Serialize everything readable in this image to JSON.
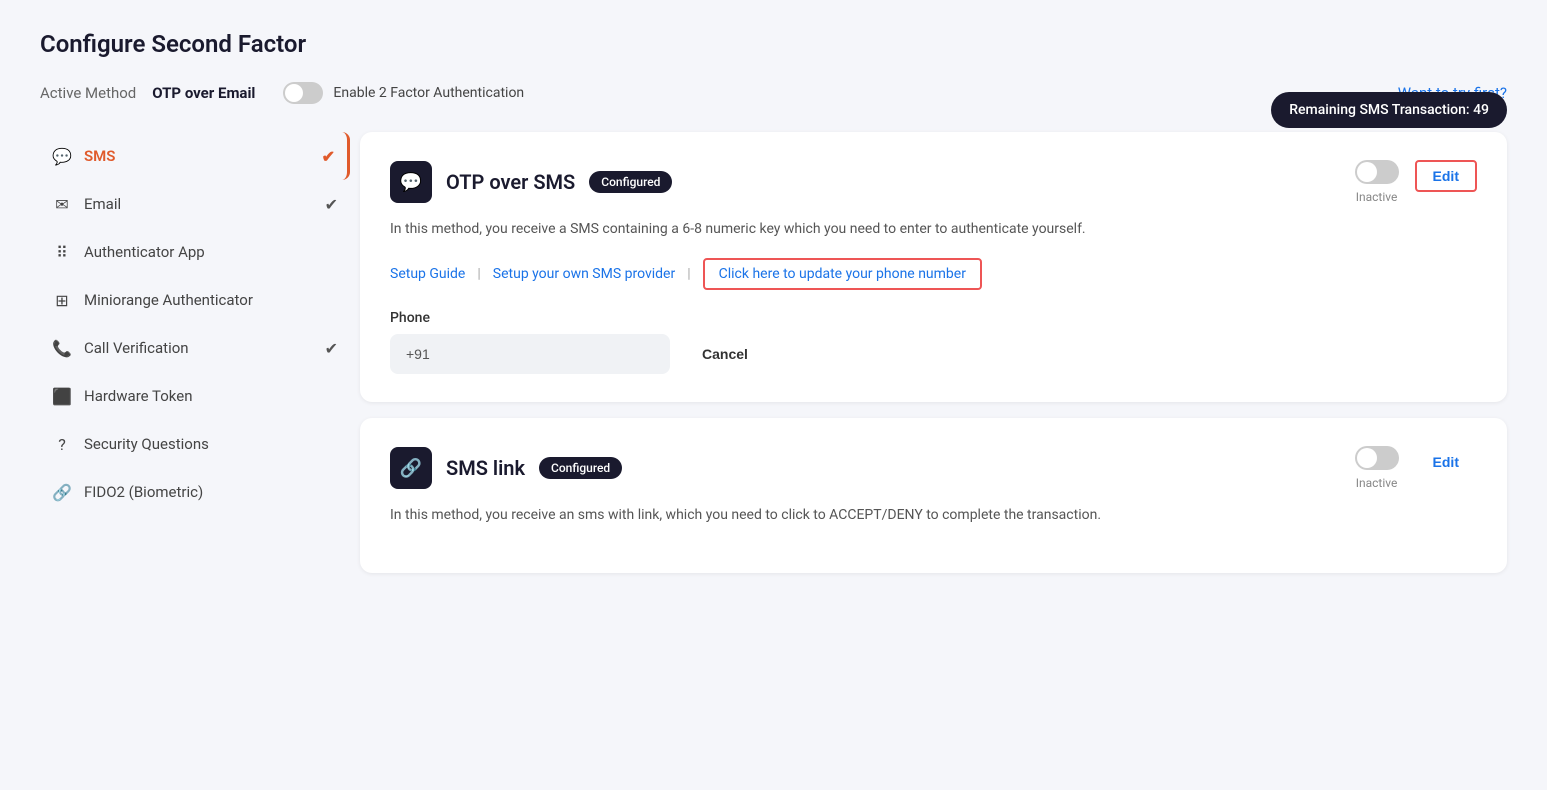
{
  "page": {
    "title": "Configure Second Factor"
  },
  "topBar": {
    "activeMethodLabel": "Active Method",
    "activeMethodValue": "OTP over Email",
    "toggleLabel": "Enable 2 Factor Authentication",
    "wantToTry": "Want to try first?"
  },
  "sidebar": {
    "items": [
      {
        "id": "sms",
        "label": "SMS",
        "icon": "💬",
        "active": true,
        "checked": true
      },
      {
        "id": "email",
        "label": "Email",
        "icon": "✉️",
        "active": false,
        "checked": true
      },
      {
        "id": "authenticator-app",
        "label": "Authenticator App",
        "icon": "⠿",
        "active": false,
        "checked": false
      },
      {
        "id": "miniorange-authenticator",
        "label": "Miniorange Authenticator",
        "icon": "⊞",
        "active": false,
        "checked": false
      },
      {
        "id": "call-verification",
        "label": "Call Verification",
        "icon": "📞",
        "active": false,
        "checked": true
      },
      {
        "id": "hardware-token",
        "label": "Hardware Token",
        "icon": "⬛",
        "active": false,
        "checked": false
      },
      {
        "id": "security-questions",
        "label": "Security Questions",
        "icon": "?",
        "active": false,
        "checked": false
      },
      {
        "id": "fido2",
        "label": "FIDO2 (Biometric)",
        "icon": "🔗",
        "active": false,
        "checked": false
      }
    ]
  },
  "smsBadge": "Remaining SMS Transaction: 49",
  "methods": [
    {
      "id": "otp-sms",
      "icon": "💬",
      "title": "OTP over SMS",
      "badge": "Configured",
      "description": "In this method, you receive a SMS containing a 6-8 numeric key which you need to enter to authenticate yourself.",
      "setupGuide": "Setup Guide",
      "setupOwnProvider": "Setup your own SMS provider",
      "updatePhone": "Click here to update your phone number",
      "phonePlaceholder": "+91",
      "phoneLabel": "Phone",
      "cancelLabel": "Cancel",
      "statusLabel": "Inactive",
      "editLabel": "Edit",
      "active": false
    },
    {
      "id": "sms-link",
      "icon": "🔗",
      "title": "SMS link",
      "badge": "Configured",
      "description": "In this method, you receive an sms with link, which you need to click to ACCEPT/DENY to complete the transaction.",
      "statusLabel": "Inactive",
      "editLabel": "Edit",
      "active": false
    }
  ]
}
